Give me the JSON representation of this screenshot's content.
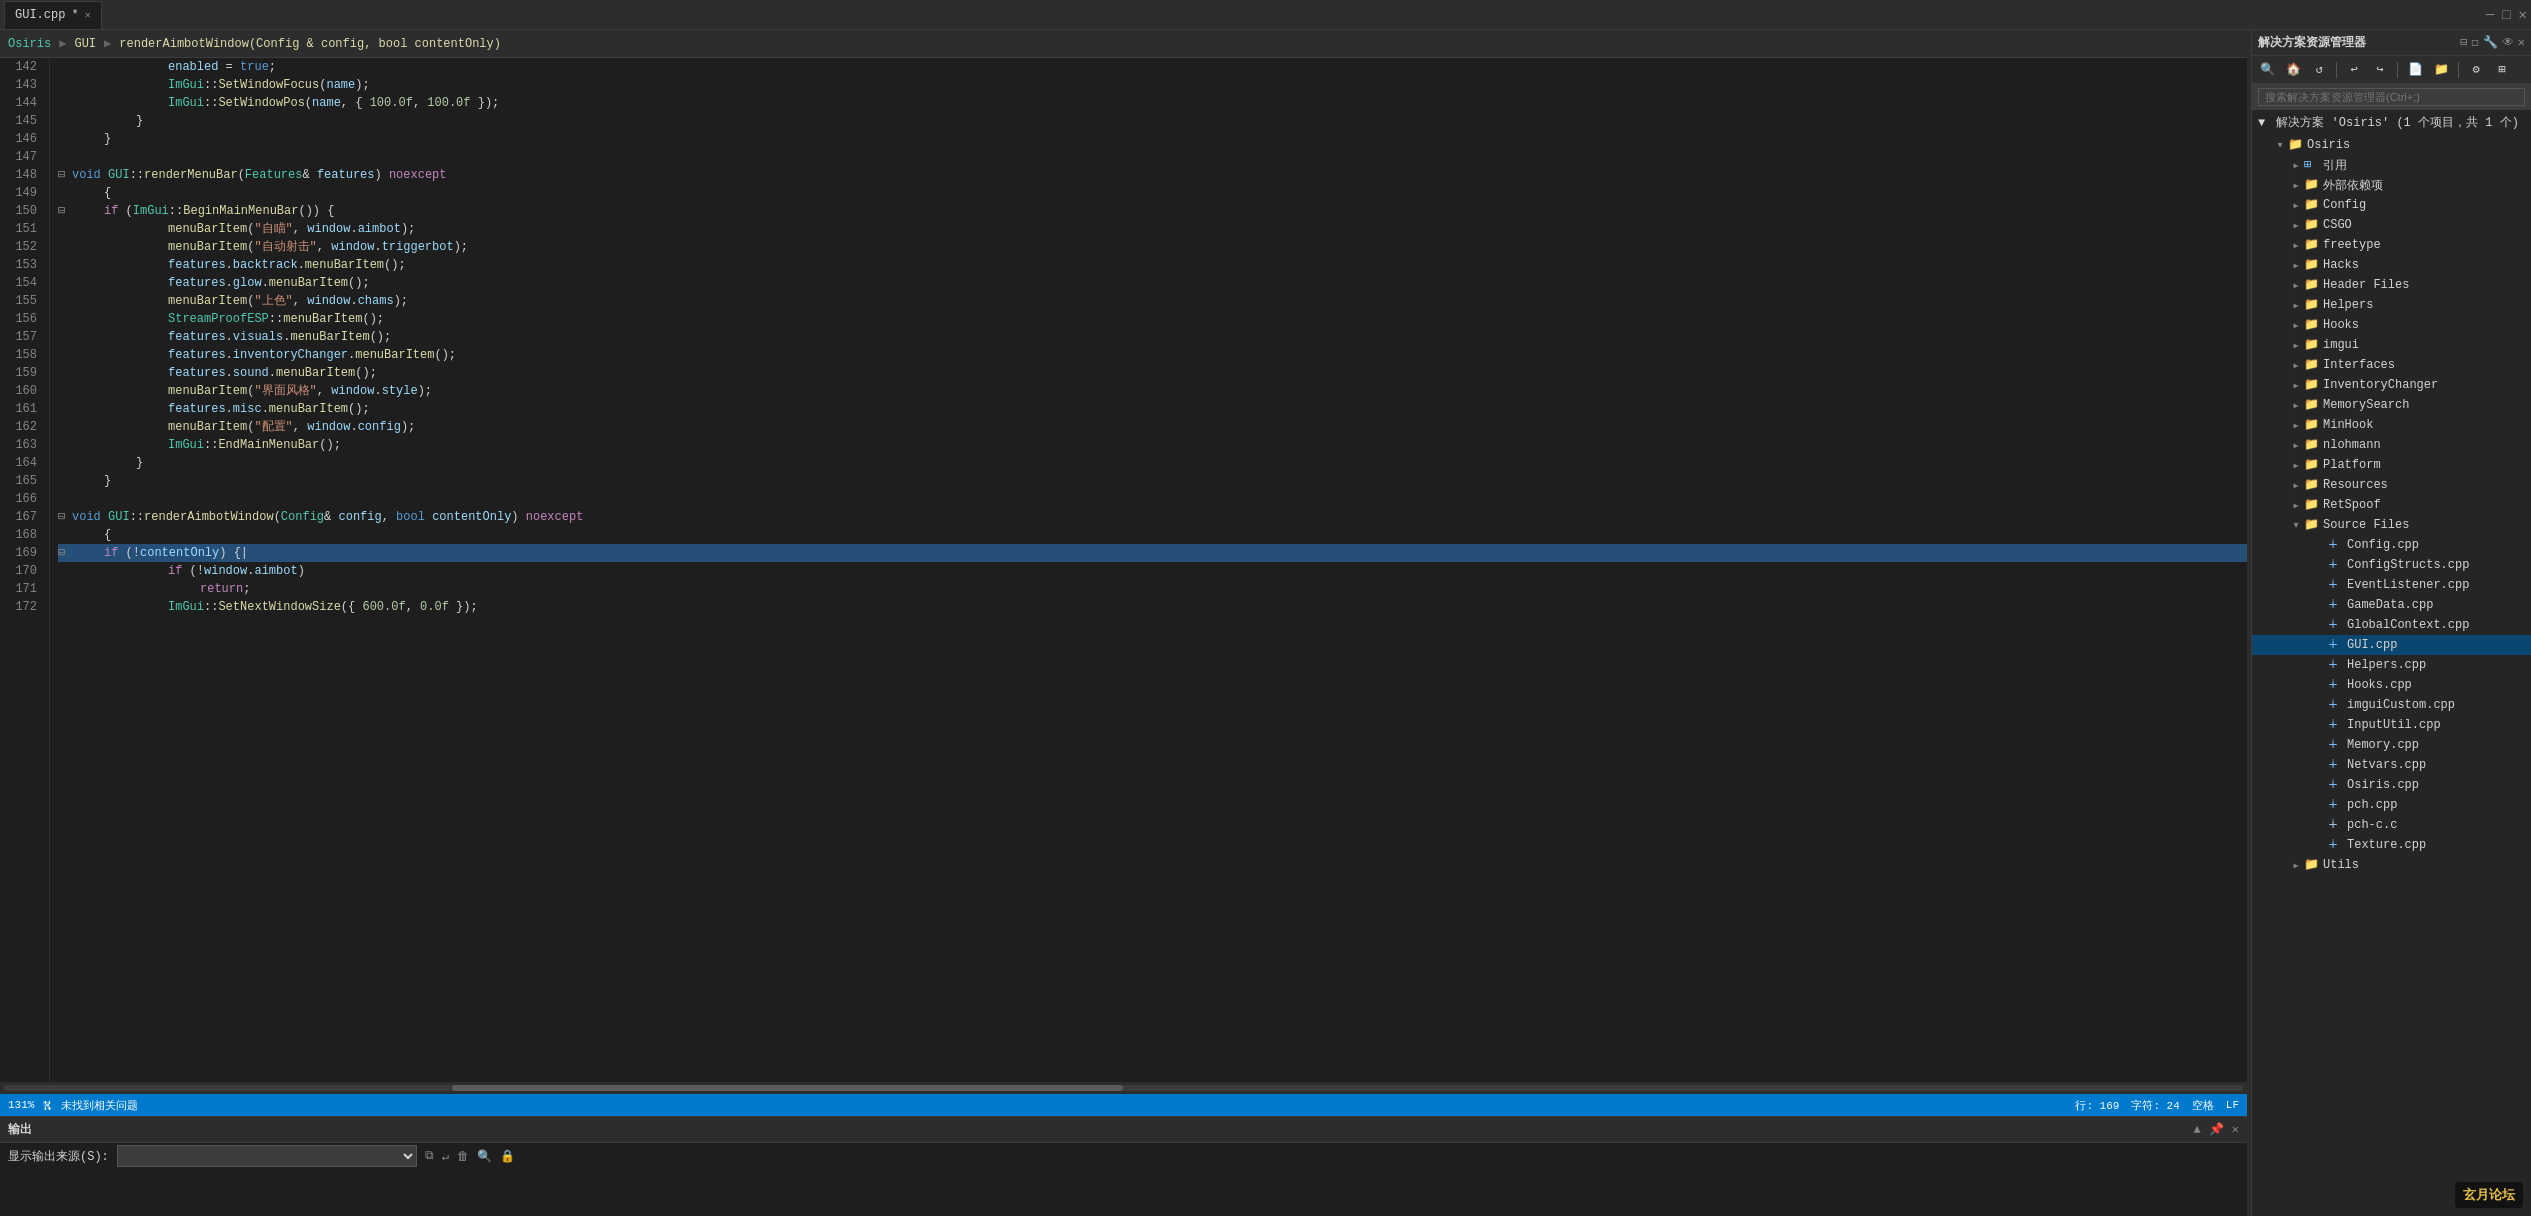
{
  "tabs": [
    {
      "label": "GUI.cpp",
      "active": true,
      "modified": true
    },
    {
      "label": "",
      "active": false
    }
  ],
  "code_toolbar": {
    "project": "Osiris",
    "separator1": "▶",
    "category": "GUI",
    "separator2": "▶",
    "function": "renderAimbotWindow(Config & config, bool contentOnly)"
  },
  "code": {
    "lines": [
      {
        "num": 142,
        "indent": 3,
        "fold": false,
        "content": "enabled = true;"
      },
      {
        "num": 143,
        "indent": 3,
        "fold": false,
        "content": "ImGui::SetWindowFocus(name);"
      },
      {
        "num": 144,
        "indent": 3,
        "fold": false,
        "content": "ImGui::SetWindowPos(name, { 100.0f, 100.0f });"
      },
      {
        "num": 145,
        "indent": 2,
        "fold": false,
        "content": "}"
      },
      {
        "num": 146,
        "indent": 1,
        "fold": false,
        "content": "}"
      },
      {
        "num": 147,
        "indent": 0,
        "fold": false,
        "content": ""
      },
      {
        "num": 148,
        "indent": 0,
        "fold": true,
        "content": "void GUI::renderMenuBar(Features& features) noexcept"
      },
      {
        "num": 149,
        "indent": 1,
        "fold": false,
        "content": "{"
      },
      {
        "num": 150,
        "indent": 1,
        "fold": true,
        "content": "if (ImGui::BeginMainMenuBar()) {"
      },
      {
        "num": 151,
        "indent": 3,
        "fold": false,
        "content": "menuBarItem(\"自瞄\", window.aimbot);"
      },
      {
        "num": 152,
        "indent": 3,
        "fold": false,
        "content": "menuBarItem(\"自动射击\", window.triggerbot);"
      },
      {
        "num": 153,
        "indent": 3,
        "fold": false,
        "content": "features.backtrack.menuBarItem();"
      },
      {
        "num": 154,
        "indent": 3,
        "fold": false,
        "content": "features.glow.menuBarItem();"
      },
      {
        "num": 155,
        "indent": 3,
        "fold": false,
        "content": "menuBarItem(\"上色\", window.chams);"
      },
      {
        "num": 156,
        "indent": 3,
        "fold": false,
        "content": "StreamProofESP::menuBarItem();"
      },
      {
        "num": 157,
        "indent": 3,
        "fold": false,
        "content": "features.visuals.menuBarItem();"
      },
      {
        "num": 158,
        "indent": 3,
        "fold": false,
        "content": "features.inventoryChanger.menuBarItem();"
      },
      {
        "num": 159,
        "indent": 3,
        "fold": false,
        "content": "features.sound.menuBarItem();"
      },
      {
        "num": 160,
        "indent": 3,
        "fold": false,
        "content": "menuBarItem(\"界面风格\", window.style);"
      },
      {
        "num": 161,
        "indent": 3,
        "fold": false,
        "content": "features.misc.menuBarItem();"
      },
      {
        "num": 162,
        "indent": 3,
        "fold": false,
        "content": "menuBarItem(\"配置\", window.config);"
      },
      {
        "num": 163,
        "indent": 3,
        "fold": false,
        "content": "ImGui::EndMainMenuBar();"
      },
      {
        "num": 164,
        "indent": 2,
        "fold": false,
        "content": "}"
      },
      {
        "num": 165,
        "indent": 1,
        "fold": false,
        "content": "}"
      },
      {
        "num": 166,
        "indent": 0,
        "fold": false,
        "content": ""
      },
      {
        "num": 167,
        "indent": 0,
        "fold": true,
        "content": "void GUI::renderAimbotWindow(Config& config, bool contentOnly) noexcept"
      },
      {
        "num": 168,
        "indent": 1,
        "fold": false,
        "content": "{"
      },
      {
        "num": 169,
        "indent": 1,
        "fold": true,
        "content": "if (!contentOnly) {",
        "highlighted": true
      },
      {
        "num": 170,
        "indent": 3,
        "fold": false,
        "content": "if (!window.aimbot)"
      },
      {
        "num": 171,
        "indent": 4,
        "fold": false,
        "content": "return;"
      },
      {
        "num": 172,
        "indent": 3,
        "fold": false,
        "content": "ImGui::SetNextWindowSize({ 600.0f, 0.0f });"
      }
    ]
  },
  "status_bar": {
    "zoom": "131%",
    "git_icon": "⑆",
    "status": "未找到相关问题",
    "line": "行: 169",
    "col": "字符: 24",
    "indent": "空格",
    "encoding": "LF"
  },
  "output_panel": {
    "title": "输出",
    "source_label": "显示输出来源(S):",
    "source_value": ""
  },
  "right_panel": {
    "title": "解决方案资源管理器",
    "search_placeholder": "搜索解决方案资源管理器(Ctrl+;)",
    "solution_label": "解决方案 'Osiris' (1 个项目，共 1 个)",
    "project": "Osiris",
    "tree": [
      {
        "level": 1,
        "type": "folder",
        "label": "引用",
        "expanded": false
      },
      {
        "level": 1,
        "type": "folder",
        "label": "外部依赖项",
        "expanded": false
      },
      {
        "level": 1,
        "type": "folder",
        "label": "Config",
        "expanded": false
      },
      {
        "level": 1,
        "type": "folder",
        "label": "CSGO",
        "expanded": false
      },
      {
        "level": 1,
        "type": "folder",
        "label": "freetype",
        "expanded": false
      },
      {
        "level": 1,
        "type": "folder",
        "label": "Hacks",
        "expanded": false
      },
      {
        "level": 1,
        "type": "folder",
        "label": "Header Files",
        "expanded": false
      },
      {
        "level": 1,
        "type": "folder",
        "label": "Helpers",
        "expanded": false
      },
      {
        "level": 1,
        "type": "folder",
        "label": "Hooks",
        "expanded": false
      },
      {
        "level": 1,
        "type": "folder",
        "label": "imgui",
        "expanded": false
      },
      {
        "level": 1,
        "type": "folder",
        "label": "Interfaces",
        "expanded": false
      },
      {
        "level": 1,
        "type": "folder",
        "label": "InventoryChanger",
        "expanded": false
      },
      {
        "level": 1,
        "type": "folder",
        "label": "MemorySearch",
        "expanded": false
      },
      {
        "level": 1,
        "type": "folder",
        "label": "MinHook",
        "expanded": false
      },
      {
        "level": 1,
        "type": "folder",
        "label": "nlohmann",
        "expanded": false
      },
      {
        "level": 1,
        "type": "folder",
        "label": "Platform",
        "expanded": false
      },
      {
        "level": 1,
        "type": "folder",
        "label": "Resources",
        "expanded": false
      },
      {
        "level": 1,
        "type": "folder",
        "label": "RetSpoof",
        "expanded": false
      },
      {
        "level": 1,
        "type": "folder",
        "label": "Source Files",
        "expanded": true
      },
      {
        "level": 2,
        "type": "cpp",
        "label": "Config.cpp"
      },
      {
        "level": 2,
        "type": "cpp",
        "label": "ConfigStructs.cpp"
      },
      {
        "level": 2,
        "type": "cpp",
        "label": "EventListener.cpp"
      },
      {
        "level": 2,
        "type": "cpp",
        "label": "GameData.cpp"
      },
      {
        "level": 2,
        "type": "cpp",
        "label": "GlobalContext.cpp"
      },
      {
        "level": 2,
        "type": "cpp",
        "label": "GUI.cpp",
        "selected": true
      },
      {
        "level": 2,
        "type": "cpp",
        "label": "Helpers.cpp"
      },
      {
        "level": 2,
        "type": "cpp",
        "label": "Hooks.cpp"
      },
      {
        "level": 2,
        "type": "cpp",
        "label": "imguiCustom.cpp"
      },
      {
        "level": 2,
        "type": "cpp",
        "label": "InputUtil.cpp"
      },
      {
        "level": 2,
        "type": "cpp",
        "label": "Memory.cpp"
      },
      {
        "level": 2,
        "type": "cpp",
        "label": "Netvars.cpp"
      },
      {
        "level": 2,
        "type": "cpp",
        "label": "Osiris.cpp"
      },
      {
        "level": 2,
        "type": "cpp",
        "label": "pch.cpp"
      },
      {
        "level": 2,
        "type": "h",
        "label": "pch-c.c"
      },
      {
        "level": 2,
        "type": "cpp",
        "label": "Texture.cpp"
      },
      {
        "level": 1,
        "type": "folder",
        "label": "Utils",
        "expanded": false
      }
    ]
  },
  "logo": {
    "text": "玄月论坛"
  }
}
